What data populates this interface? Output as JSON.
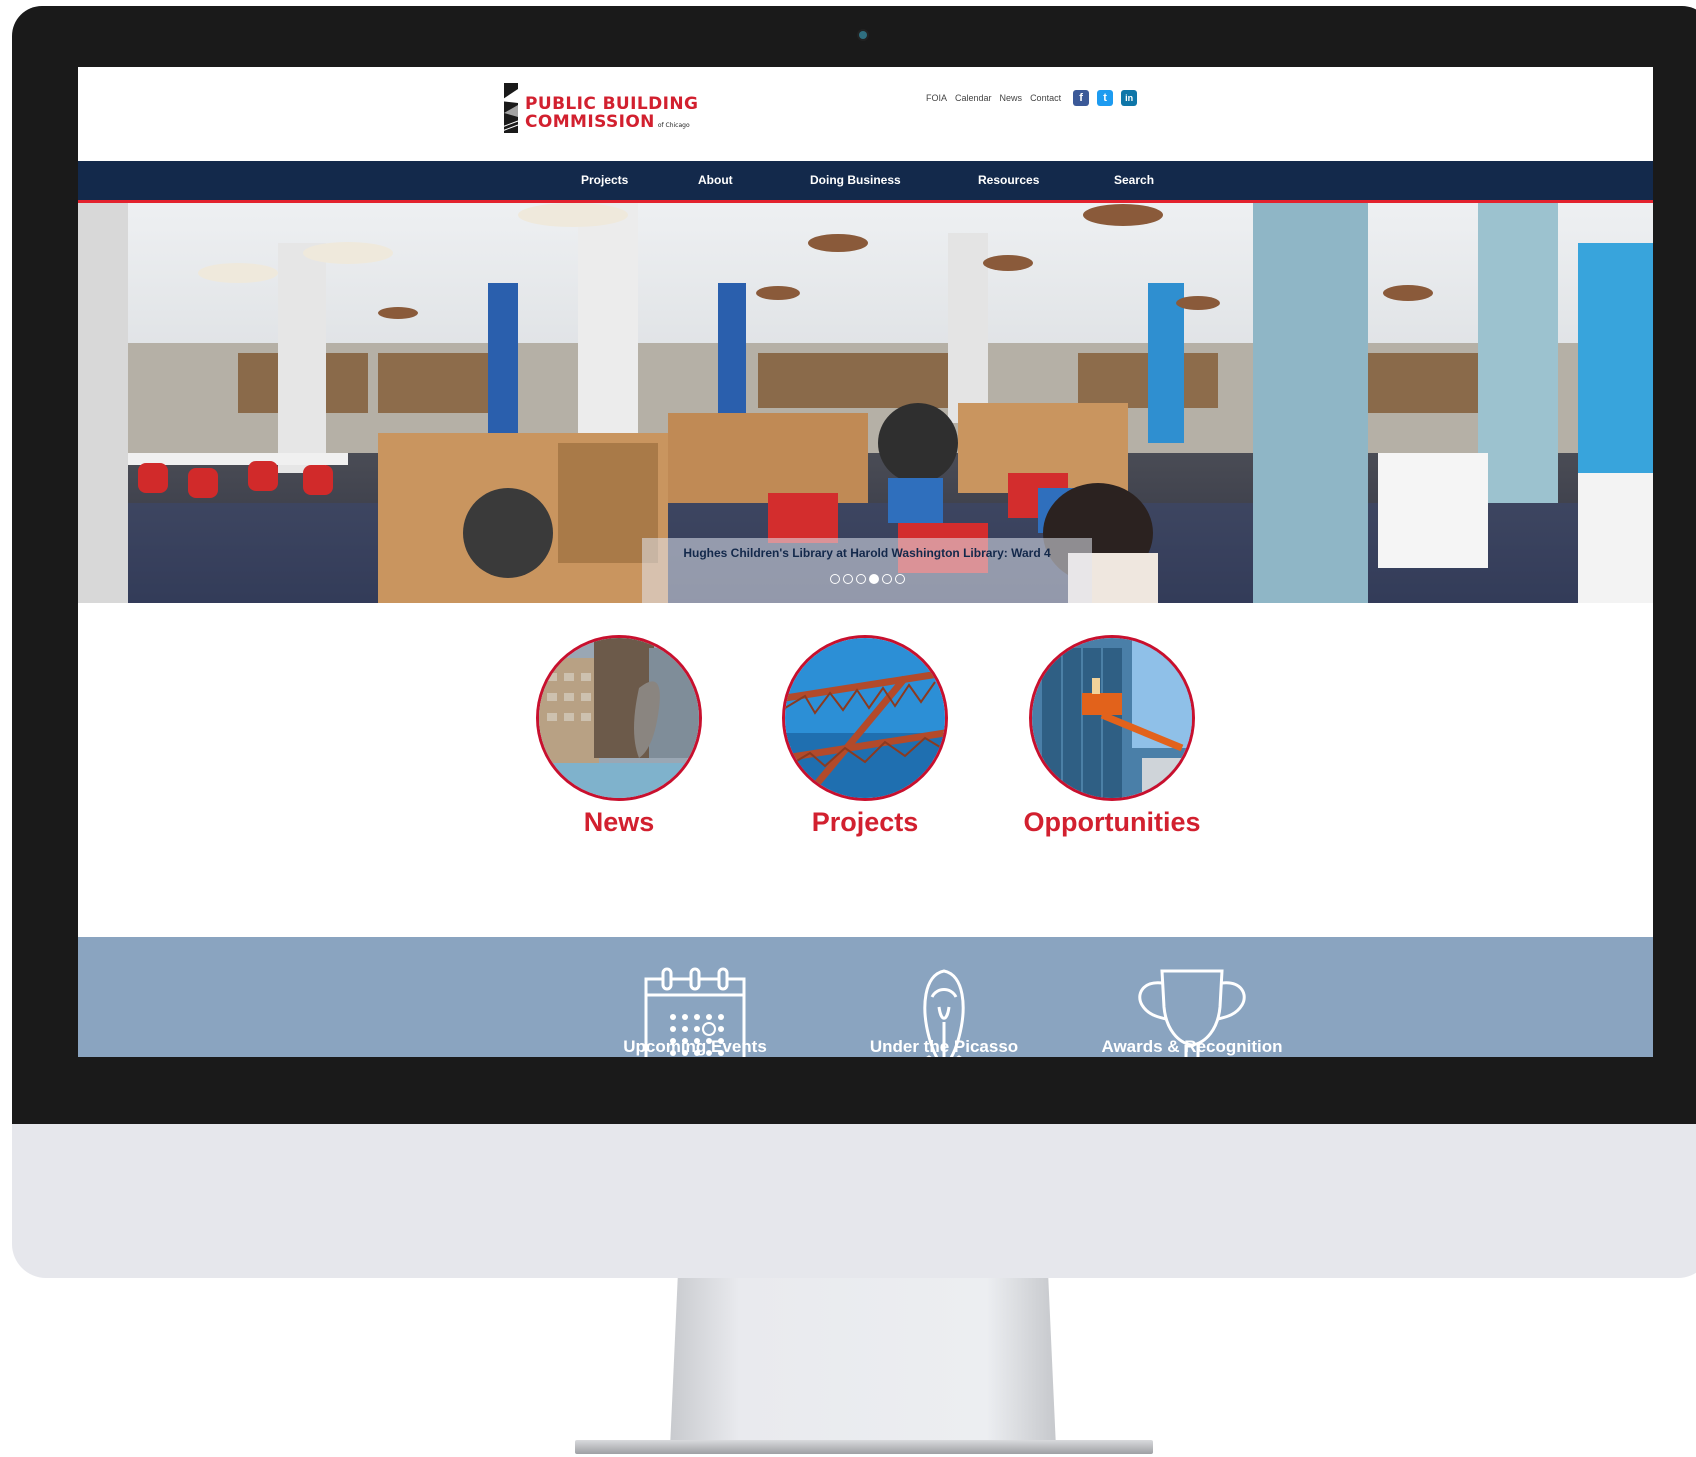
{
  "logo": {
    "line1": "PUBLIC BUILDING",
    "line2": "COMMISSION",
    "small": "of Chicago"
  },
  "utility_links": [
    "FOIA",
    "Calendar",
    "News",
    "Contact"
  ],
  "social": {
    "facebook": "f",
    "twitter": "t",
    "linkedin": "in"
  },
  "nav": [
    "Projects",
    "About",
    "Doing Business",
    "Resources",
    "Search"
  ],
  "hero": {
    "caption": "Hughes Children's Library at Harold Washington Library: Ward 4",
    "slide_count": 6,
    "active_slide": 4
  },
  "features": [
    {
      "label": "News",
      "icon": "news-photo"
    },
    {
      "label": "Projects",
      "icon": "steel-structure-photo"
    },
    {
      "label": "Opportunities",
      "icon": "construction-lift-photo"
    }
  ],
  "band": [
    {
      "label": "Upcoming Events",
      "icon": "calendar-icon"
    },
    {
      "label": "Under the Picasso",
      "icon": "picasso-sculpture-icon"
    },
    {
      "label": "Awards & Recognition",
      "icon": "trophy-icon"
    }
  ],
  "colors": {
    "brand_red": "#d2202f",
    "nav_navy": "#13294b",
    "band_blue": "#8aa4c0"
  }
}
